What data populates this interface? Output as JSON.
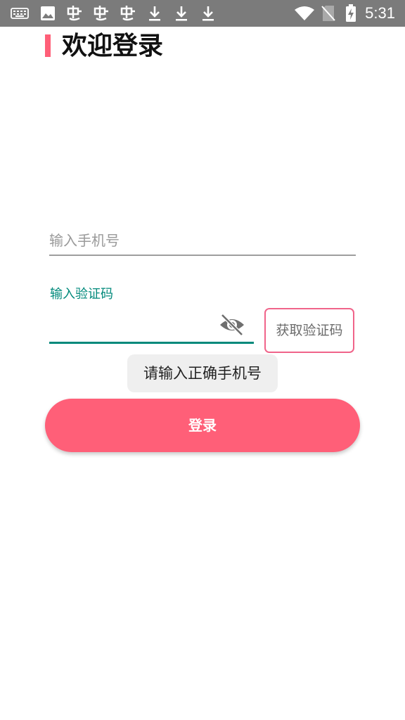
{
  "status_bar": {
    "time": "5:31",
    "icons": [
      "keyboard-icon",
      "image-icon",
      "bug-icon",
      "bug-icon",
      "bug-icon",
      "download-icon",
      "download-icon",
      "download-icon",
      "wifi-icon",
      "no-sim-icon",
      "battery-charging-icon"
    ]
  },
  "header": {
    "title": "欢迎登录",
    "accent_color": "#ff5f78"
  },
  "form": {
    "phone_placeholder": "输入手机号",
    "code_label": "输入验证码",
    "get_code_label": "获取验证码",
    "accent_color": "#00897b"
  },
  "toast": {
    "message": "请输入正确手机号"
  },
  "login": {
    "label": "登录"
  }
}
